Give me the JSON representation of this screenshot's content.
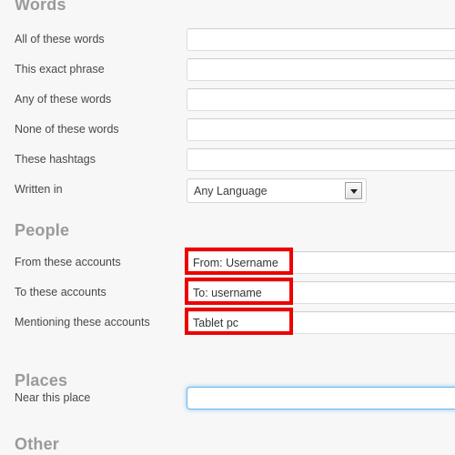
{
  "page": {
    "background_color": "#f7f7f7",
    "heading_color": "#9a9a9a",
    "label_color": "#46484a",
    "annotation_color": "#ee0000",
    "focus_color": "#6cb9ef"
  },
  "sections": {
    "words": {
      "heading": "Words",
      "rows": [
        {
          "label": "All of these words",
          "value": "",
          "placeholder": ""
        },
        {
          "label": "This exact phrase",
          "value": "",
          "placeholder": ""
        },
        {
          "label": "Any of these words",
          "value": "",
          "placeholder": ""
        },
        {
          "label": "None of these words",
          "value": "",
          "placeholder": ""
        },
        {
          "label": "These hashtags",
          "value": "",
          "placeholder": ""
        }
      ],
      "written_in": {
        "label": "Written in",
        "selected": "Any Language"
      }
    },
    "people": {
      "heading": "People",
      "rows": [
        {
          "label": "From these accounts",
          "value": "From: Username",
          "placeholder": "",
          "highlighted": true
        },
        {
          "label": "To these accounts",
          "value": "To: username",
          "placeholder": "",
          "highlighted": true
        },
        {
          "label": "Mentioning these accounts",
          "value": "Tablet pc",
          "placeholder": "",
          "highlighted": true
        }
      ]
    },
    "places": {
      "heading": "Places",
      "rows": [
        {
          "label": "Near this place",
          "value": "",
          "placeholder": "",
          "focused": true
        }
      ]
    },
    "other": {
      "heading": "Other"
    }
  }
}
